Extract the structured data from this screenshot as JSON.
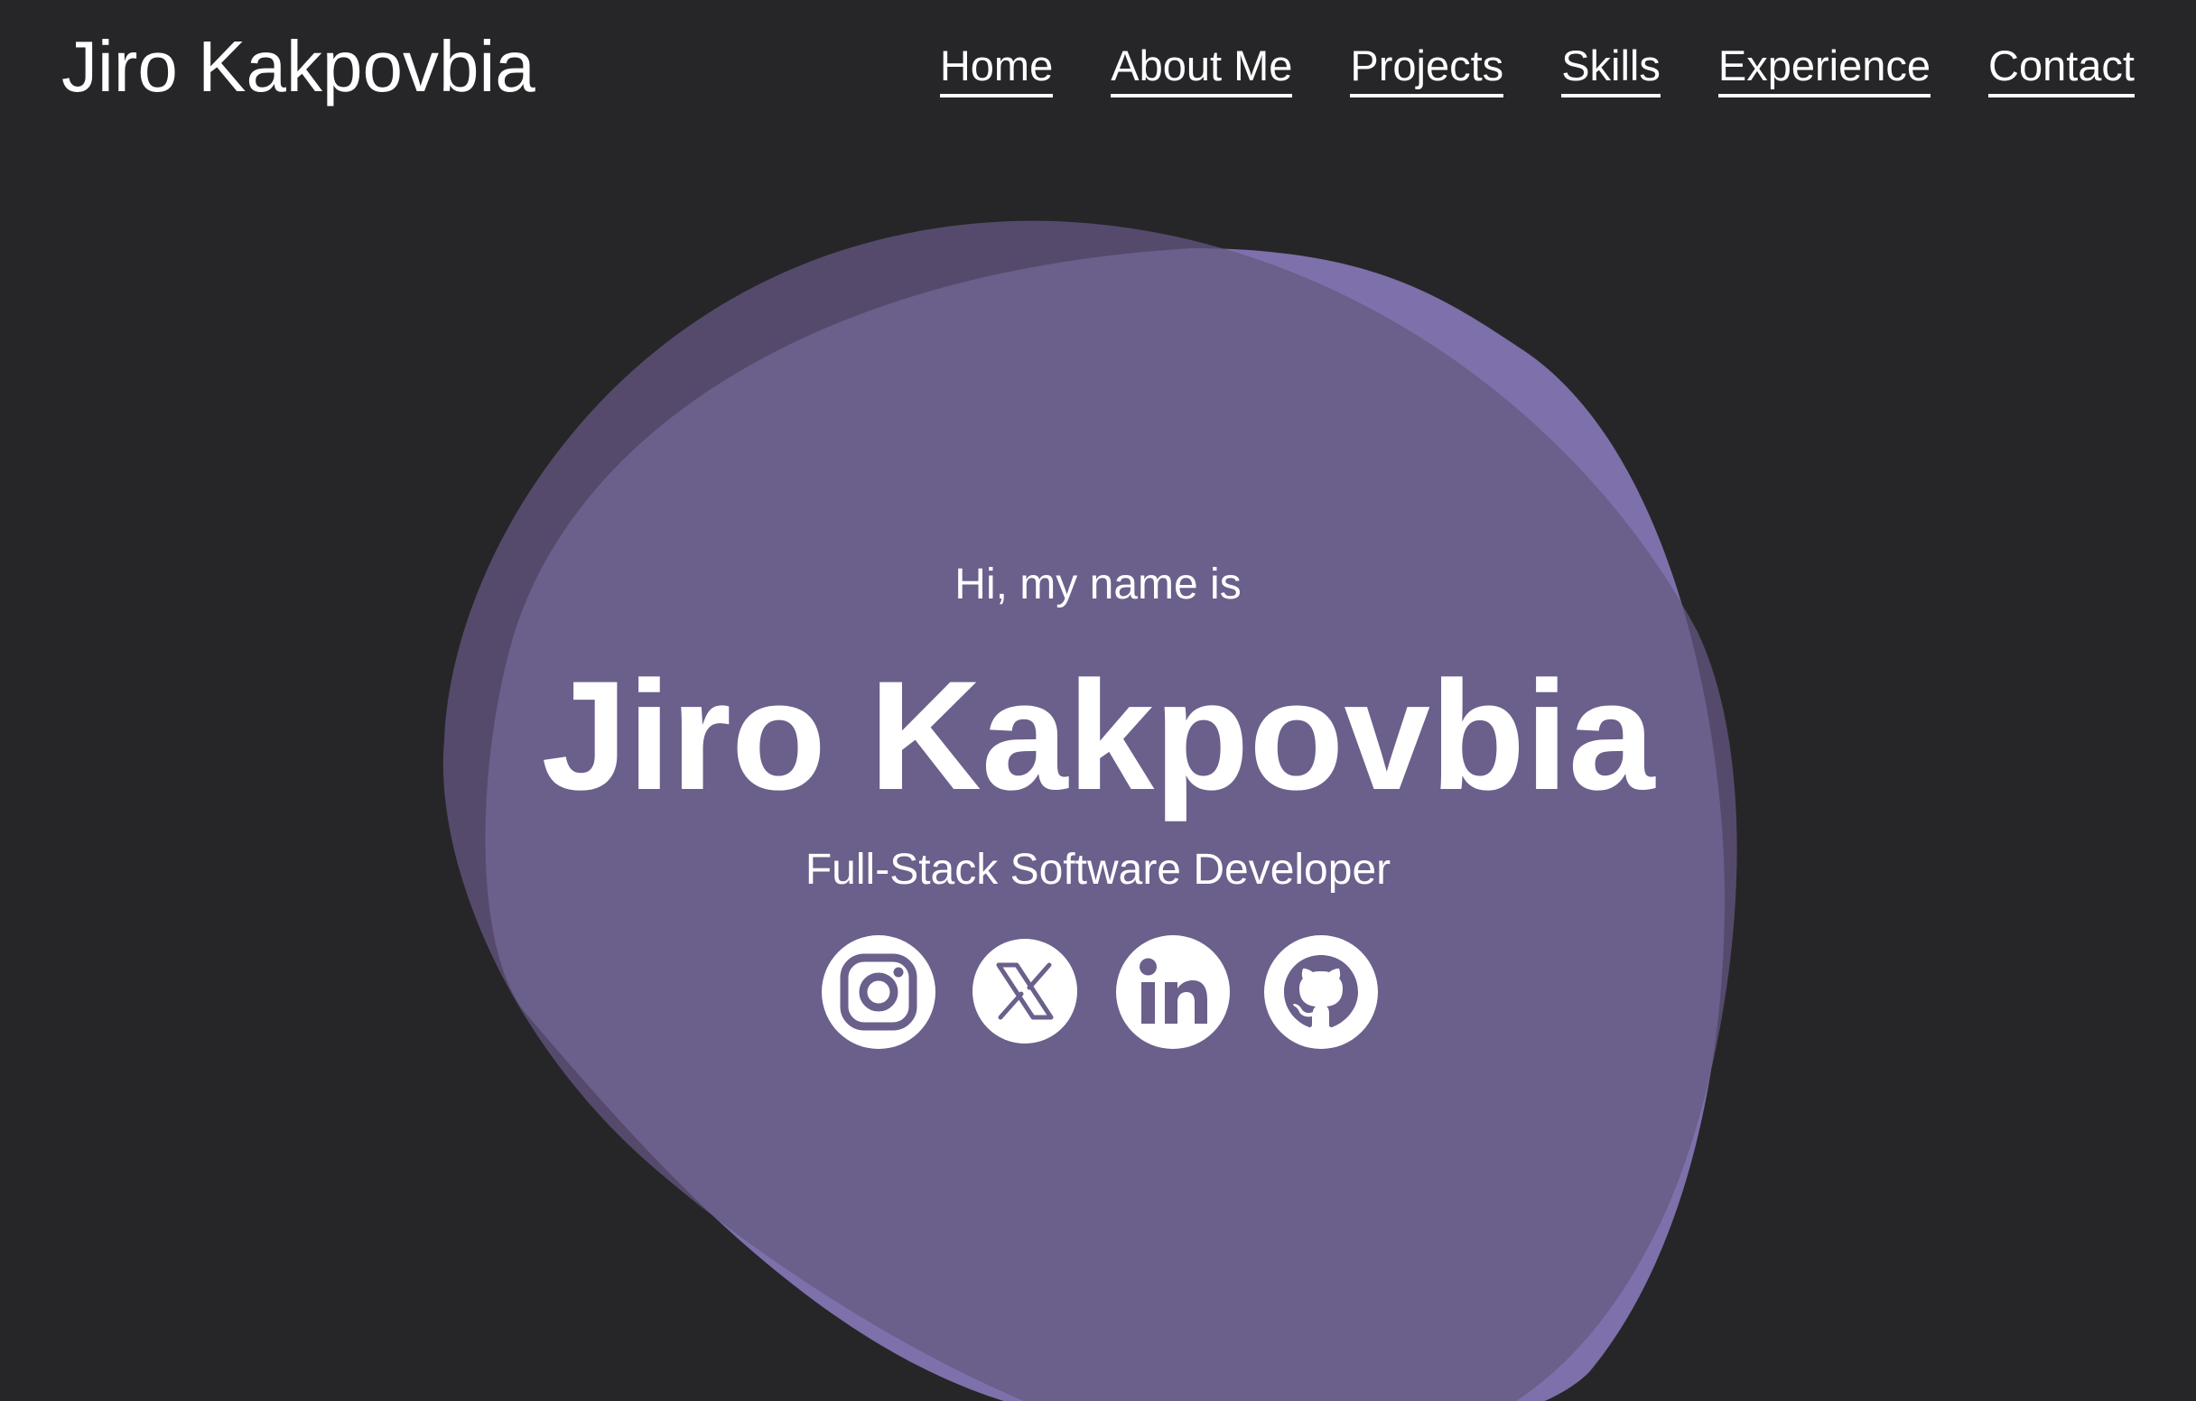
{
  "header": {
    "brand": "Jiro Kakpovbia",
    "nav": [
      {
        "label": "Home"
      },
      {
        "label": "About Me"
      },
      {
        "label": "Projects"
      },
      {
        "label": "Skills"
      },
      {
        "label": "Experience"
      },
      {
        "label": "Contact"
      }
    ]
  },
  "hero": {
    "greeting": "Hi, my name is",
    "name": "Jiro Kakpovbia",
    "role": "Full-Stack Software Developer",
    "socials": [
      {
        "icon": "instagram-icon"
      },
      {
        "icon": "x-icon"
      },
      {
        "icon": "linkedin-icon"
      },
      {
        "icon": "github-icon"
      }
    ]
  },
  "colors": {
    "background": "#262628",
    "blob_light": "#7e70aa",
    "blob_dark": "#554a6c",
    "blob_overlap": "#6b5f8b",
    "text": "#ffffff"
  }
}
